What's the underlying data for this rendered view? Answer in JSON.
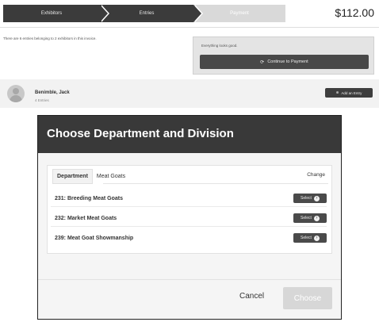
{
  "steps": [
    {
      "label": "Exhibitors"
    },
    {
      "label": "Entries"
    },
    {
      "label": "Payment"
    }
  ],
  "total": "$112.00",
  "info_text": "There are 6 entries belonging to 2 exhibitors in this invoice.",
  "payment": {
    "label": "Everything looks good.",
    "button_label": "Continue to Payment"
  },
  "exhibitor": {
    "name": "Benimble, Jack",
    "entries": "4 Entries",
    "add_button_label": "Add an Entry"
  },
  "modal": {
    "title": "Choose Department and Division",
    "tab_label": "Department",
    "tab_value": "Meat Goats",
    "change_label": "Change",
    "divisions": [
      {
        "name": "231: Breeding Meat Goats",
        "select_label": "Select"
      },
      {
        "name": "232: Market Meat Goats",
        "select_label": "Select"
      },
      {
        "name": "239: Meat Goat Showmanship",
        "select_label": "Select"
      }
    ],
    "cancel_label": "Cancel",
    "choose_label": "Choose"
  },
  "colors": {
    "header_dark": "#393939",
    "button_dark": "#484848",
    "disabled": "#d7d7d7"
  },
  "icons": {
    "payment_button": "refresh-icon",
    "add_button": "plus-circle-icon",
    "select_button": "arrow-right-circle-icon",
    "avatar": "user-avatar-icon"
  }
}
